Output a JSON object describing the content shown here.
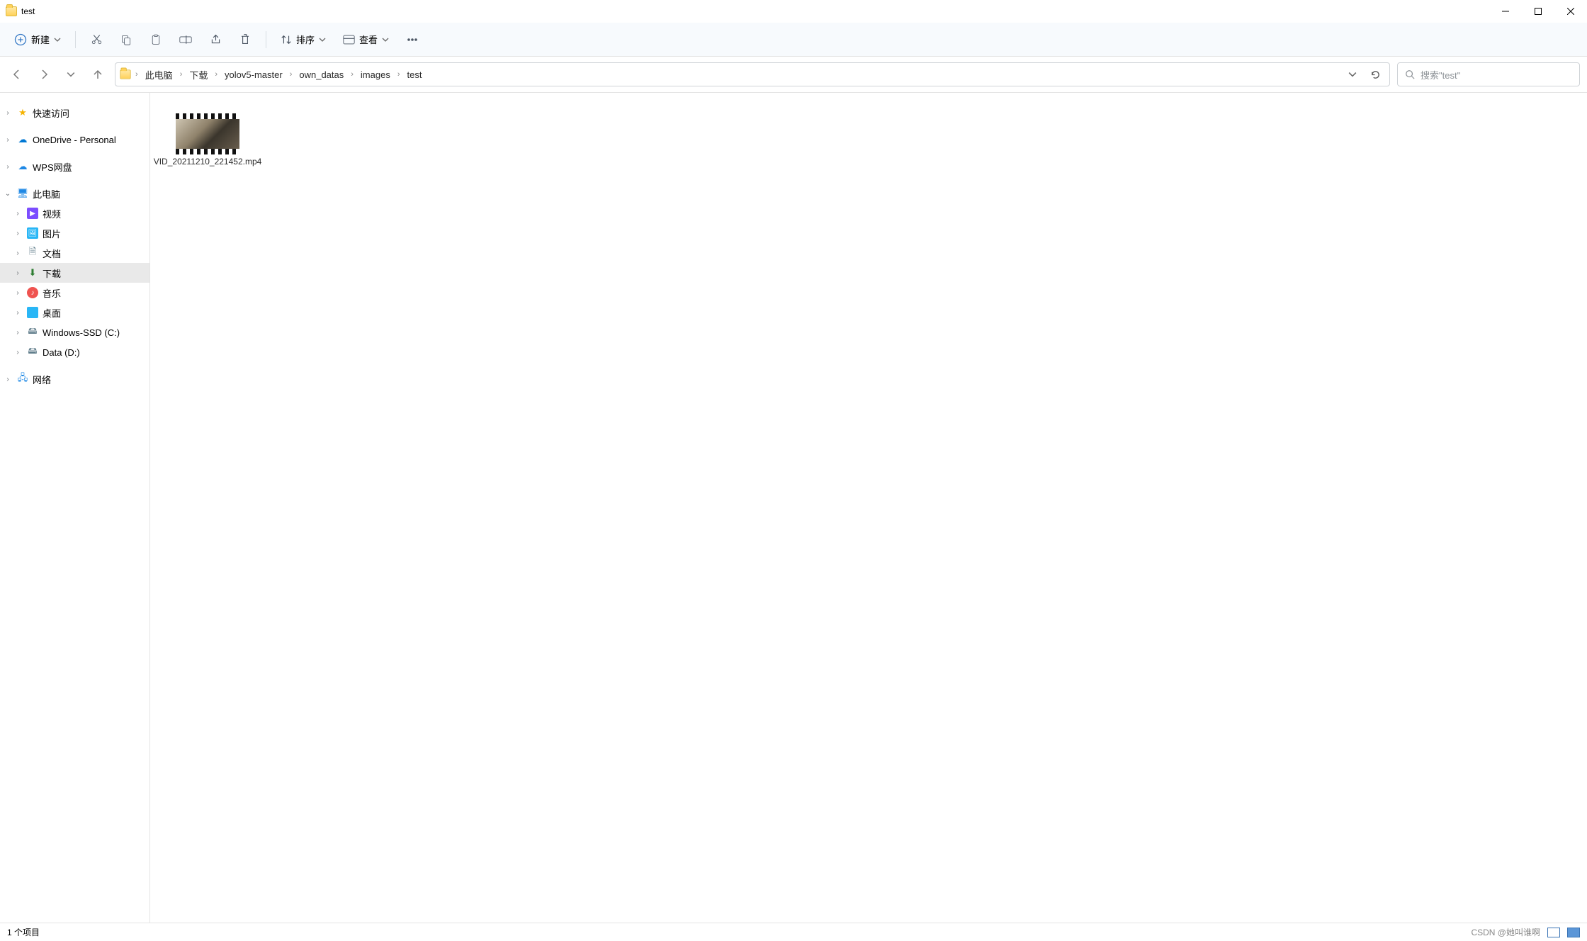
{
  "window": {
    "title": "test"
  },
  "toolbar": {
    "newLabel": "新建",
    "sortLabel": "排序",
    "viewLabel": "查看",
    "icons": {
      "new": "plus-circle-icon",
      "cut": "cut-icon",
      "copy": "copy-icon",
      "paste": "paste-icon",
      "rename": "rename-icon",
      "share": "share-icon",
      "delete": "delete-icon",
      "sort": "sort-icon",
      "view": "view-icon",
      "more": "more-icon"
    }
  },
  "breadcrumb": [
    "此电脑",
    "下载",
    "yolov5-master",
    "own_datas",
    "images",
    "test"
  ],
  "search": {
    "placeholder": "搜索\"test\""
  },
  "nav": {
    "quickAccess": "快速访问",
    "oneDrive": "OneDrive - Personal",
    "wps": "WPS网盘",
    "thisPC": "此电脑",
    "videos": "视频",
    "pictures": "图片",
    "documents": "文档",
    "downloads": "下载",
    "music": "音乐",
    "desktop": "桌面",
    "driveC": "Windows-SSD (C:)",
    "driveD": "Data (D:)",
    "network": "网络"
  },
  "files": [
    {
      "name": "VID_20211210_221452.mp4"
    }
  ],
  "status": {
    "itemCount": "1 个项目"
  },
  "watermark": "CSDN @她叫谁啊"
}
